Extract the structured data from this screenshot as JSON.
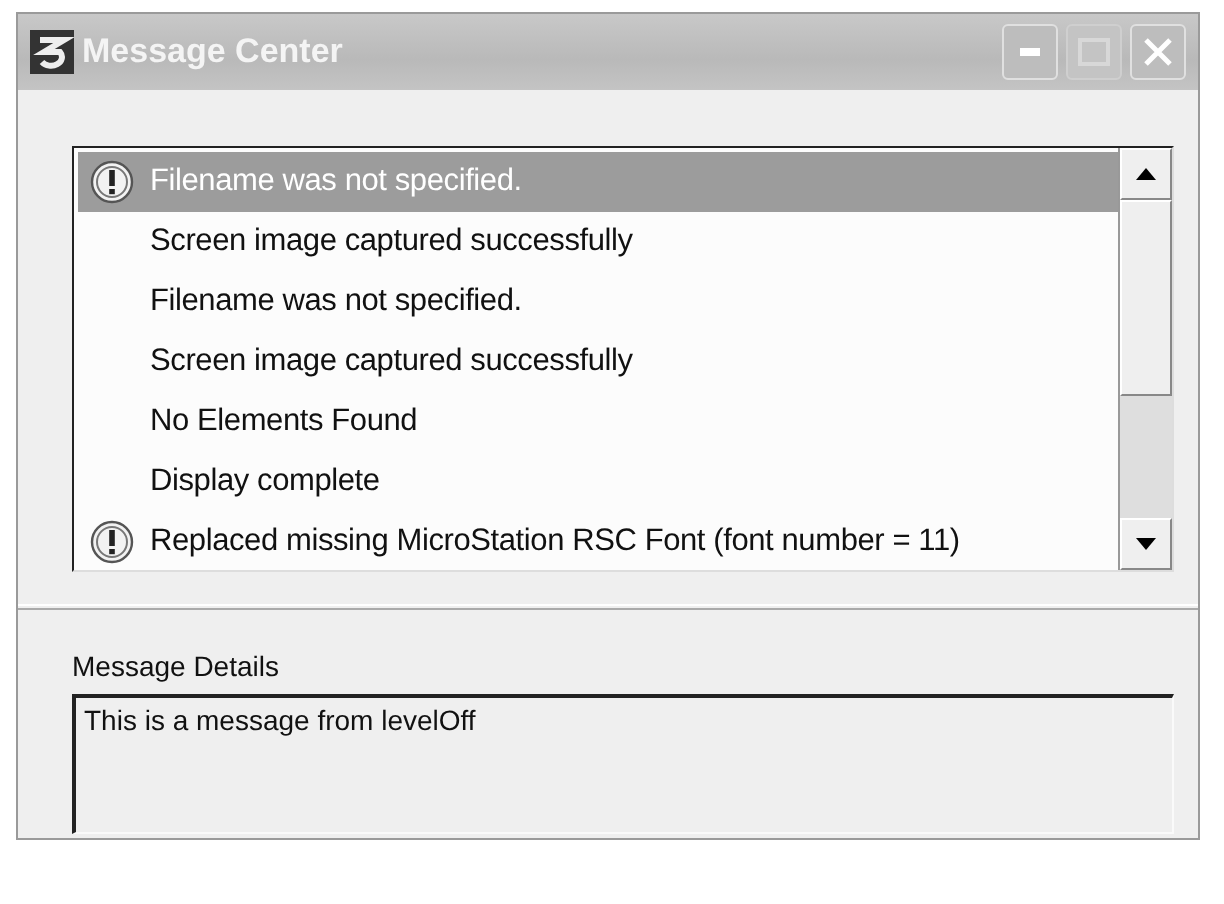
{
  "window": {
    "title": "Message Center"
  },
  "messages": [
    {
      "text": "Filename was not specified.",
      "kind": "warning",
      "selected": true
    },
    {
      "text": "Screen image captured successfully",
      "kind": "info",
      "selected": false
    },
    {
      "text": "Filename was not specified.",
      "kind": "info",
      "selected": false
    },
    {
      "text": "Screen image captured successfully",
      "kind": "info",
      "selected": false
    },
    {
      "text": "No Elements Found",
      "kind": "info",
      "selected": false
    },
    {
      "text": "Display complete",
      "kind": "info",
      "selected": false
    },
    {
      "text": "Replaced missing MicroStation RSC Font (font number = 11)",
      "kind": "warning",
      "selected": false
    }
  ],
  "details": {
    "label": "Message Details",
    "value": "This is a message from levelOff"
  }
}
